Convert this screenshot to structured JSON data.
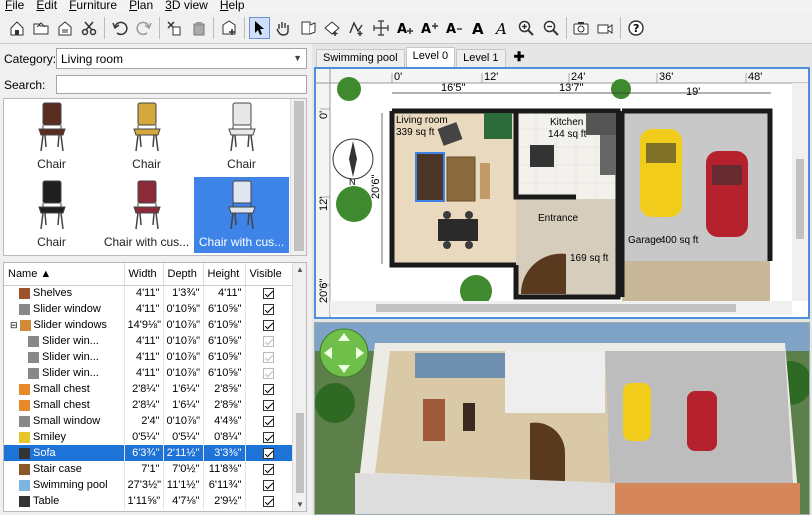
{
  "menu": [
    "File",
    "Edit",
    "Furniture",
    "Plan",
    "3D view",
    "Help"
  ],
  "toolbar_icons": [
    "new-home-icon",
    "open-icon",
    "save-icon",
    "cut-icon",
    "undo-icon",
    "redo-icon",
    "copy-icon",
    "paste-icon",
    "add-furniture-icon",
    "select-arrow-icon",
    "pan-hand-icon",
    "create-walls-icon",
    "create-rooms-icon",
    "create-polylines-icon",
    "create-dimensions-icon",
    "add-text-icon",
    "increase-text-icon",
    "text-style-icon",
    "bold-text-icon",
    "italic-text-icon",
    "zoom-in-icon",
    "zoom-out-icon",
    "photo-icon",
    "video-icon",
    "help-icon"
  ],
  "catalog": {
    "category_label": "Category:",
    "category_value": "Living room",
    "search_label": "Search:",
    "search_value": "",
    "items": [
      {
        "label": "Chair",
        "color": "#5a2b1f",
        "selected": false
      },
      {
        "label": "Chair",
        "color": "#d4a83c",
        "selected": false
      },
      {
        "label": "Chair",
        "color": "#e8e8e8",
        "selected": false
      },
      {
        "label": "Chair",
        "color": "#1f1f1f",
        "selected": false
      },
      {
        "label": "Chair with cus...",
        "color": "#8c2a3a",
        "selected": false
      },
      {
        "label": "Chair with cus...",
        "color": "#dfe6ef",
        "selected": true
      }
    ]
  },
  "furniture": {
    "columns": [
      "Name ▲",
      "Width",
      "Depth",
      "Height",
      "Visible"
    ],
    "rows": [
      {
        "name": "Shelves",
        "w": "4'11\"",
        "d": "1'3¾\"",
        "h": "4'11\"",
        "icon": "shelves-icon",
        "color": "#a0522d",
        "indent": 1,
        "visible": true,
        "sel": false
      },
      {
        "name": "Slider window",
        "w": "4'11\"",
        "d": "0'10⅝\"",
        "h": "6'10⅝\"",
        "icon": "window-icon",
        "color": "#888",
        "indent": 1,
        "visible": true,
        "sel": false
      },
      {
        "name": "Slider windows",
        "w": "14'9⅛\"",
        "d": "0'10⅞\"",
        "h": "6'10⅝\"",
        "icon": "group-icon",
        "color": "#d08a3a",
        "indent": 0,
        "visible": true,
        "sel": false,
        "group": true
      },
      {
        "name": "Slider win...",
        "w": "4'11\"",
        "d": "0'10⅞\"",
        "h": "6'10⅝\"",
        "icon": "window-icon",
        "color": "#888",
        "indent": 2,
        "visible": true,
        "dim": true,
        "sel": false
      },
      {
        "name": "Slider win...",
        "w": "4'11\"",
        "d": "0'10⅞\"",
        "h": "6'10⅝\"",
        "icon": "window-icon",
        "color": "#888",
        "indent": 2,
        "visible": true,
        "dim": true,
        "sel": false
      },
      {
        "name": "Slider win...",
        "w": "4'11\"",
        "d": "0'10⅞\"",
        "h": "6'10⅝\"",
        "icon": "window-icon",
        "color": "#888",
        "indent": 2,
        "visible": true,
        "dim": true,
        "sel": false
      },
      {
        "name": "Small chest",
        "w": "2'8¼\"",
        "d": "1'6¼\"",
        "h": "2'8⅝\"",
        "icon": "chest-icon",
        "color": "#e88a2a",
        "indent": 1,
        "visible": true,
        "sel": false
      },
      {
        "name": "Small chest",
        "w": "2'8¼\"",
        "d": "1'6¼\"",
        "h": "2'8⅝\"",
        "icon": "chest-icon",
        "color": "#e88a2a",
        "indent": 1,
        "visible": true,
        "sel": false
      },
      {
        "name": "Small window",
        "w": "2'4\"",
        "d": "0'10⅞\"",
        "h": "4'4⅜\"",
        "icon": "window-icon",
        "color": "#888",
        "indent": 1,
        "visible": true,
        "sel": false
      },
      {
        "name": "Smiley",
        "w": "0'5¼\"",
        "d": "0'5¼\"",
        "h": "0'8¼\"",
        "icon": "smiley-icon",
        "color": "#e8c52a",
        "indent": 1,
        "visible": true,
        "sel": false
      },
      {
        "name": "Sofa",
        "w": "6'3¾\"",
        "d": "2'11½\"",
        "h": "3'3⅜\"",
        "icon": "sofa-icon",
        "color": "#333",
        "indent": 1,
        "visible": true,
        "sel": true
      },
      {
        "name": "Stair case",
        "w": "7'1\"",
        "d": "7'0½\"",
        "h": "11'8⅜\"",
        "icon": "stairs-icon",
        "color": "#8b5a2b",
        "indent": 1,
        "visible": true,
        "sel": false
      },
      {
        "name": "Swimming pool",
        "w": "27'3½\"",
        "d": "11'1½\"",
        "h": "6'11¾\"",
        "icon": "pool-icon",
        "color": "#7ab6e0",
        "indent": 1,
        "visible": true,
        "sel": false
      },
      {
        "name": "Table",
        "w": "1'11⅝\"",
        "d": "4'7⅛\"",
        "h": "2'9½\"",
        "icon": "table-icon",
        "color": "#333",
        "indent": 1,
        "visible": true,
        "sel": false
      }
    ]
  },
  "levels": {
    "tabs": [
      "Swimming pool",
      "Level 0",
      "Level 1"
    ],
    "active": "Level 0",
    "add": "✚"
  },
  "plan": {
    "ruler_top": [
      "0'",
      "12'",
      "24'",
      "36'",
      "48'"
    ],
    "ruler_left": [
      "0'",
      "12'",
      "20'6\""
    ],
    "dims": [
      "16'5\"",
      "13'7\"",
      "19'",
      "20'6\""
    ],
    "compass": "N",
    "rooms": [
      {
        "name": "Living room",
        "area": "339 sq ft"
      },
      {
        "name": "Kitchen",
        "area": "144 sq ft"
      },
      {
        "name": "Entrance",
        "area": ""
      },
      {
        "name": "",
        "area": "169 sq ft"
      },
      {
        "name": "Garage",
        "area": "400 sq ft"
      }
    ],
    "colors": {
      "wall": "#1a1a1a",
      "floor_living": "#e8d9bf",
      "floor_entrance": "#d6cdbd",
      "garage_floor": "#c8c8c8",
      "car_yellow": "#f2cc1a",
      "car_red": "#b5222e",
      "grass": "#3f8a2e"
    }
  }
}
